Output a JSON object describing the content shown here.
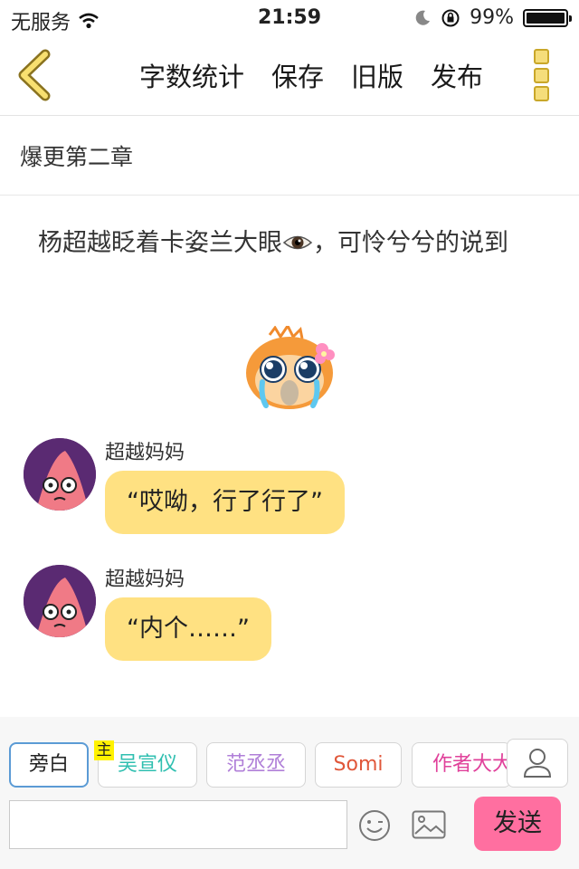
{
  "status_bar": {
    "carrier": "无服务",
    "time": "21:59",
    "battery_percent": "99%",
    "battery_level": 0.99,
    "icons": [
      "wifi-icon",
      "moon-icon",
      "orientation-lock-icon",
      "battery-icon"
    ]
  },
  "nav": {
    "back_icon": "chevron-left-icon",
    "actions": [
      "字数统计",
      "保存",
      "旧版",
      "发布"
    ],
    "more_icon": "vertical-dots-icon",
    "accent_color": "#f5dd7a"
  },
  "chapter": {
    "title": "爆更第二章"
  },
  "content": {
    "narration": "杨超越眨着卡姿兰大眼",
    "narration_suffix": "，可怜兮兮的说到",
    "sticker_icon": "crying-cute-sticker",
    "messages": [
      {
        "sender": "超越妈妈",
        "text": "“哎呦，行了行了”"
      },
      {
        "sender": "超越妈妈",
        "text": "“内个……”"
      }
    ],
    "bubble_color": "#ffe182"
  },
  "bottom": {
    "roles": [
      {
        "label": "旁白",
        "color": "#222222"
      },
      {
        "label": "吴宣仪",
        "color": "#2fbfb0"
      },
      {
        "label": "范丞丞",
        "color": "#b07fd8"
      },
      {
        "label": "Somi",
        "color": "#e0573a"
      },
      {
        "label": "作者大大",
        "color": "#e0409a"
      }
    ],
    "host_badge": "主",
    "input_placeholder": "",
    "send_label": "发送",
    "send_color": "#ff6fa0"
  }
}
